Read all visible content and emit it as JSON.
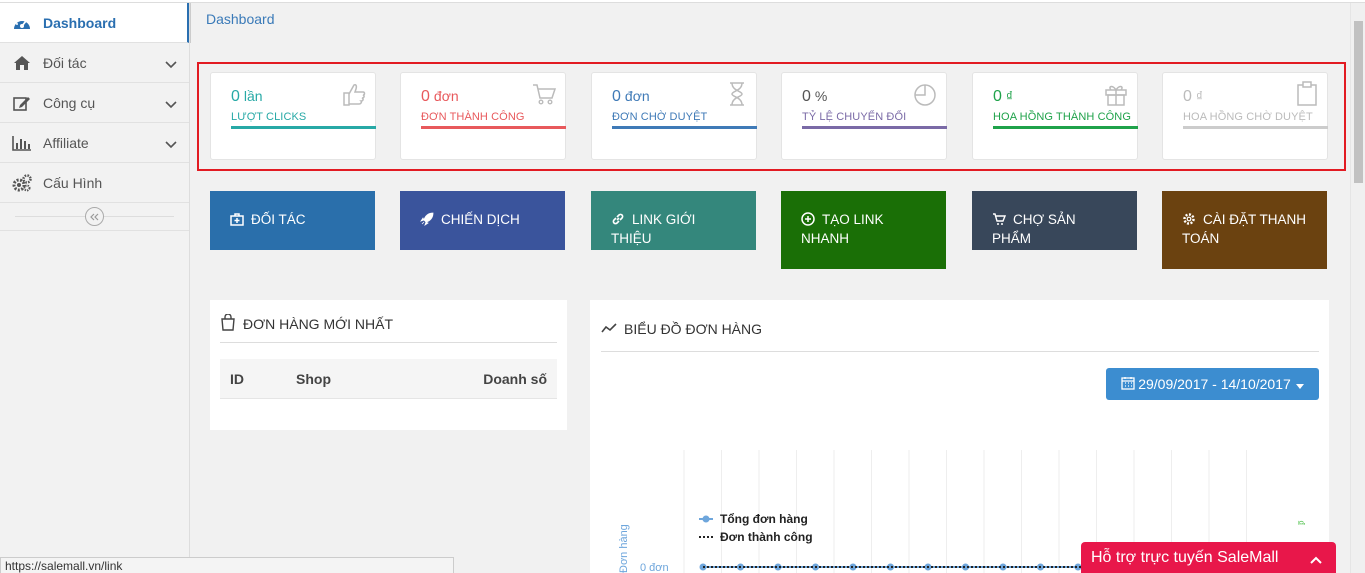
{
  "sidebar": {
    "items": [
      {
        "label": "Dashboard",
        "icon": "dashboard-icon"
      },
      {
        "label": "Đối tác",
        "icon": "home-icon"
      },
      {
        "label": "Công cụ",
        "icon": "edit-icon"
      },
      {
        "label": "Affiliate",
        "icon": "bar-chart-icon"
      },
      {
        "label": "Cấu Hình",
        "icon": "cogs-icon"
      }
    ]
  },
  "breadcrumb": "Dashboard",
  "stats": [
    {
      "value": "0",
      "unit": "lần",
      "label": "LƯỢT CLICKS",
      "color": "#27a9a6",
      "icon": "thumbs-up-icon"
    },
    {
      "value": "0",
      "unit": "đơn",
      "label": "ĐƠN THÀNH CÔNG",
      "color": "#e8595c",
      "icon": "cart-icon"
    },
    {
      "value": "0",
      "unit": "đơn",
      "label": "ĐƠN CHỜ DUYỆT",
      "color": "#3f7ab7",
      "icon": "hourglass-icon"
    },
    {
      "value": "0",
      "unit": "%",
      "label": "TỶ LỆ CHUYỂN ĐỔI",
      "color": "#7a6aa6",
      "icon": "pie-icon"
    },
    {
      "value": "0",
      "unit": "₫",
      "label": "HOA HỒNG THÀNH CÔNG",
      "color": "#1fa24a",
      "icon": "gift-icon"
    },
    {
      "value": "0",
      "unit": "₫",
      "label": "HOA HỒNG CHỜ DUYỆT",
      "color": "#bbbbbb",
      "icon": "clipboard-icon"
    }
  ],
  "buttons": [
    {
      "label": "ĐỐI TÁC",
      "color": "#2a6fab",
      "icon": "partner-icon"
    },
    {
      "label": "CHIẾN DỊCH",
      "color": "#3a549c",
      "icon": "rocket-icon"
    },
    {
      "label": "LINK GIỚI THIỆU",
      "color": "#34877c",
      "icon": "link-icon"
    },
    {
      "label": "TẠO LINK NHANH",
      "color": "#1a6f06",
      "icon": "plus-circle-icon"
    },
    {
      "label": "CHỢ SẢN PHẨM",
      "color": "#38475a",
      "icon": "cart-icon"
    },
    {
      "label": "CÀI ĐẶT THANH TOÁN",
      "color": "#6b4210",
      "icon": "gear-icon"
    }
  ],
  "orders_panel": {
    "title": "ĐƠN HÀNG MỚI NHẤT",
    "columns": [
      "ID",
      "Shop",
      "Doanh số"
    ]
  },
  "chart_panel": {
    "title": "BIỂU ĐỒ ĐƠN HÀNG",
    "date_range": "29/09/2017 - 14/10/2017"
  },
  "chart_data": {
    "type": "line",
    "title": "",
    "ylabel": "Đơn hàng",
    "y_tick_labels": [
      "0 đơn"
    ],
    "series": [
      {
        "name": "Tổng đơn hàng",
        "color": "#6ea6dc",
        "values": [
          0,
          0,
          0,
          0,
          0,
          0,
          0,
          0,
          0,
          0,
          0,
          0,
          0,
          0,
          0,
          0
        ]
      },
      {
        "name": "Đơn thành công",
        "color": "#222222",
        "values": [
          0,
          0,
          0,
          0,
          0,
          0,
          0,
          0,
          0,
          0,
          0,
          0,
          0,
          0,
          0,
          0
        ]
      }
    ],
    "right_axis_label": "₫",
    "grid": true,
    "legend": "top-left"
  },
  "status_url": "https://salemall.vn/link",
  "support": {
    "label": "Hỗ trợ trực tuyến SaleMall"
  }
}
